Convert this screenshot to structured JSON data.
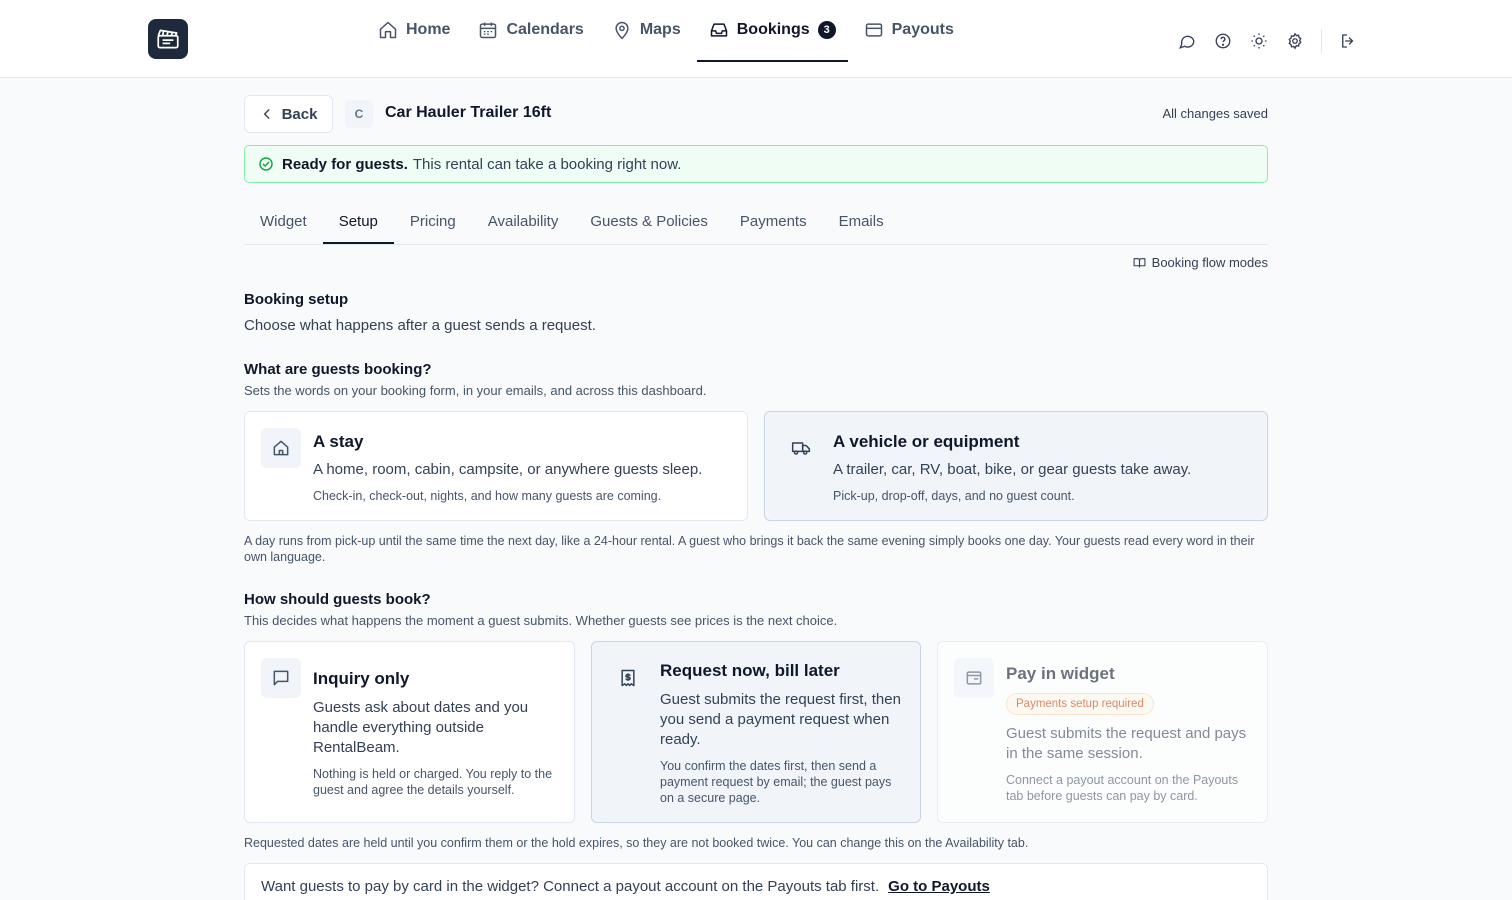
{
  "nav": {
    "logo_icon": "clapperboard-logo",
    "items": [
      {
        "label": "Home",
        "icon": "home-icon"
      },
      {
        "label": "Calendars",
        "icon": "calendar-icon"
      },
      {
        "label": "Maps",
        "icon": "map-pin-icon"
      },
      {
        "label": "Bookings",
        "icon": "inbox-icon",
        "badge": "3"
      },
      {
        "label": "Payouts",
        "icon": "credit-card-icon"
      }
    ],
    "active": "Bookings",
    "right_icons": [
      "chat-icon",
      "help-icon",
      "sun-icon",
      "settings-icon",
      "logout-icon"
    ]
  },
  "header": {
    "back_label": "Back",
    "avatar_letter": "C",
    "title": "Car Hauler Trailer 16ft",
    "save_status": "All changes saved"
  },
  "ready": {
    "bold": "Ready for guests.",
    "text": "This rental can take a booking right now."
  },
  "tabs": [
    "Widget",
    "Setup",
    "Pricing",
    "Availability",
    "Guests & Policies",
    "Payments",
    "Emails"
  ],
  "active_tab": "Setup",
  "flow_link": "Booking flow modes",
  "setup": {
    "title": "Booking setup",
    "subtitle": "Choose what happens after a guest sends a request."
  },
  "what": {
    "title": "What are guests booking?",
    "subtitle": "Sets the words on your booking form, in your emails, and across this dashboard.",
    "options": [
      {
        "title": "A stay",
        "desc": "A home, room, cabin, campsite, or anywhere guests sleep.",
        "note": "Check-in, check-out, nights, and how many guests are coming.",
        "selected": false
      },
      {
        "title": "A vehicle or equipment",
        "desc": "A trailer, car, RV, boat, bike, or gear guests take away.",
        "note": "Pick-up, drop-off, days, and no guest count.",
        "selected": true
      }
    ],
    "footnote": "A day runs from pick-up until the same time the next day, like a 24-hour rental. A guest who brings it back the same evening simply books one day. Your guests read every word in their own language."
  },
  "how": {
    "title": "How should guests book?",
    "subtitle": "This decides what happens the moment a guest submits. Whether guests see prices is the next choice.",
    "options": [
      {
        "title": "Inquiry only",
        "desc": "Guests ask about dates and you handle everything outside RentalBeam.",
        "note": "Nothing is held or charged. You reply to the guest and agree the details yourself.",
        "selected": false
      },
      {
        "title": "Request now, bill later",
        "desc": "Guest submits the request first, then you send a payment request when ready.",
        "note": "You confirm the dates first, then send a payment request by email; the guest pays on a secure page.",
        "selected": true
      },
      {
        "title": "Pay in widget",
        "badge": "Payments setup required",
        "desc": "Guest submits the request and pays in the same session.",
        "note": "Connect a payout account on the Payouts tab before guests can pay by card.",
        "disabled": true
      }
    ],
    "footnote": "Requested dates are held until you confirm them or the hold expires, so they are not booked twice. You can change this on the Availability tab."
  },
  "payout_prompt": {
    "text": "Want guests to pay by card in the widget? Connect a payout account on the Payouts tab first.",
    "link": "Go to Payouts"
  }
}
